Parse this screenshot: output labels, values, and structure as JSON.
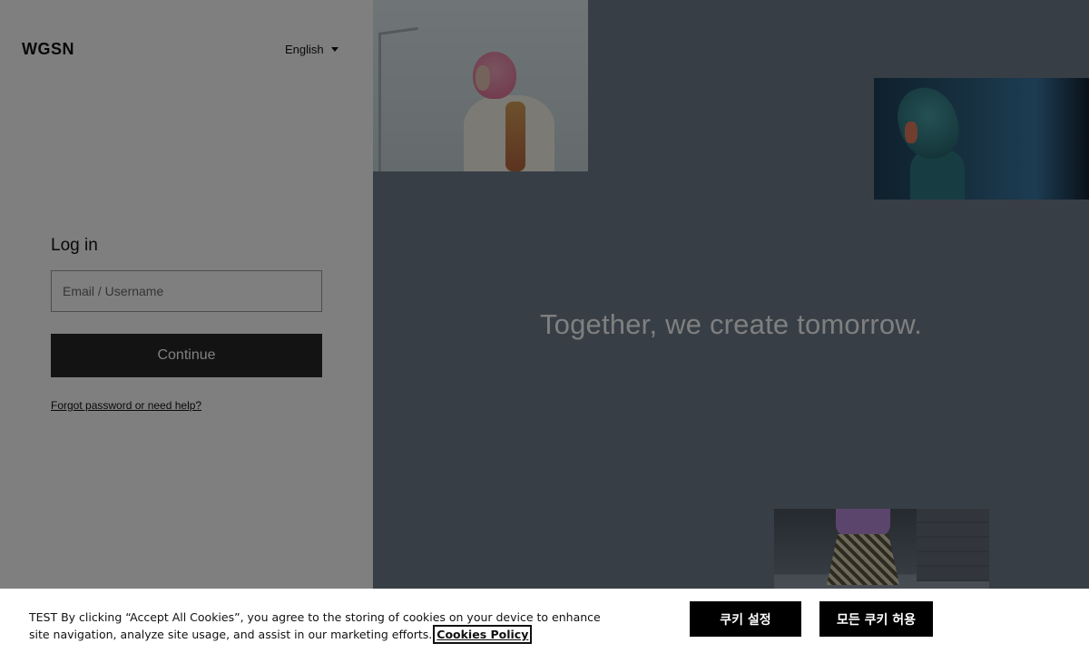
{
  "header": {
    "logo": "WGSN",
    "language": "English"
  },
  "login": {
    "title": "Log in",
    "email_placeholder": "Email / Username",
    "continue_label": "Continue",
    "forgot_link": "Forgot password or need help?"
  },
  "hero": {
    "tagline": "Together, we create tomorrow."
  },
  "cookie_banner": {
    "text": "TEST By clicking “Accept All Cookies”, you agree to the storing of cookies on your device to enhance site navigation, analyze site usage, and assist in our marketing efforts.",
    "policy_link": "Cookies Policy",
    "settings_button": "쿠키 설정",
    "accept_button": "모든 쿠키 허용"
  },
  "icons": {
    "language_dropdown": "caret-down-icon"
  }
}
